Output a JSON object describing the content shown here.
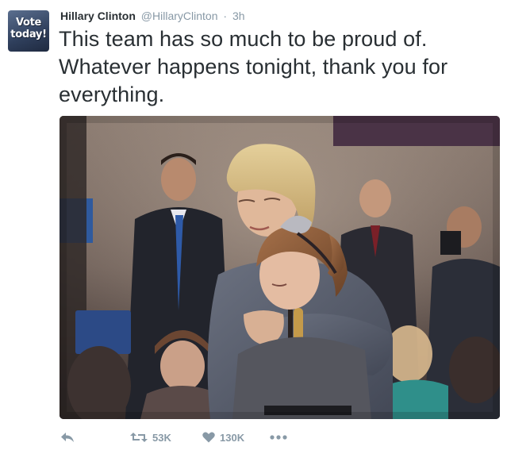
{
  "author": {
    "name": "Hillary Clinton",
    "handle": "@HillaryClinton",
    "separator": "·",
    "time": "3h",
    "avatar_text": [
      "Vote",
      "today!"
    ]
  },
  "tweet": {
    "lines": [
      "This team has so much to be proud of.",
      "Whatever happens tonight, thank you for",
      "everything."
    ]
  },
  "photo": {
    "description_name": "tweet-photo"
  },
  "actions": {
    "reply_icon": "reply-icon",
    "retweet_icon": "retweet-icon",
    "retweet_count": "53K",
    "like_icon": "heart-icon",
    "like_count": "130K",
    "more_icon": "more-icon"
  },
  "colors": {
    "text": "#292f33",
    "muted": "#8899a6"
  }
}
